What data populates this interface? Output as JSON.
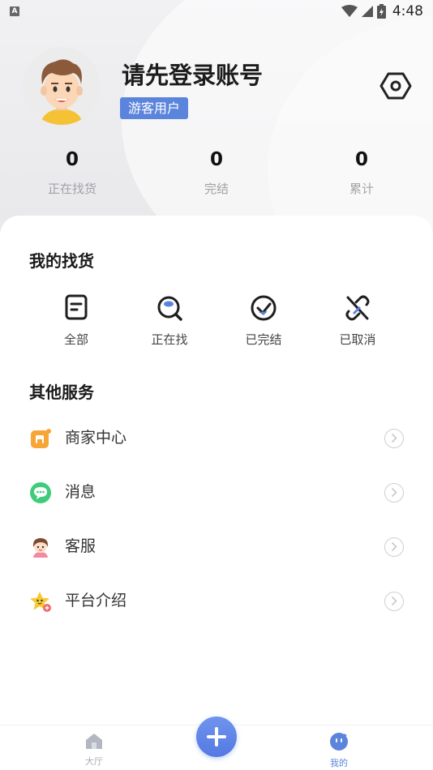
{
  "status_bar": {
    "indicator": "A",
    "time": "4:48"
  },
  "profile": {
    "username": "请先登录账号",
    "badge": "游客用户"
  },
  "stats": [
    {
      "value": "0",
      "label": "正在找货"
    },
    {
      "value": "0",
      "label": "完结"
    },
    {
      "value": "0",
      "label": "累计"
    }
  ],
  "my_search": {
    "title": "我的找货",
    "items": [
      {
        "label": "全部",
        "icon": "document-icon"
      },
      {
        "label": "正在找",
        "icon": "search-icon"
      },
      {
        "label": "已完结",
        "icon": "check-circle-icon"
      },
      {
        "label": "已取消",
        "icon": "cancel-link-icon"
      }
    ]
  },
  "other_services": {
    "title": "其他服务",
    "items": [
      {
        "label": "商家中心",
        "icon": "store-icon"
      },
      {
        "label": "消息",
        "icon": "message-icon"
      },
      {
        "label": "客服",
        "icon": "customer-service-icon"
      },
      {
        "label": "平台介绍",
        "icon": "star-icon"
      }
    ]
  },
  "tabbar": {
    "tabs": [
      {
        "label": "大厅",
        "icon": "home-icon"
      },
      {
        "label": "我的",
        "icon": "profile-face-icon"
      }
    ],
    "accent": "#5b84dc",
    "inactive": "#a9adb8"
  }
}
